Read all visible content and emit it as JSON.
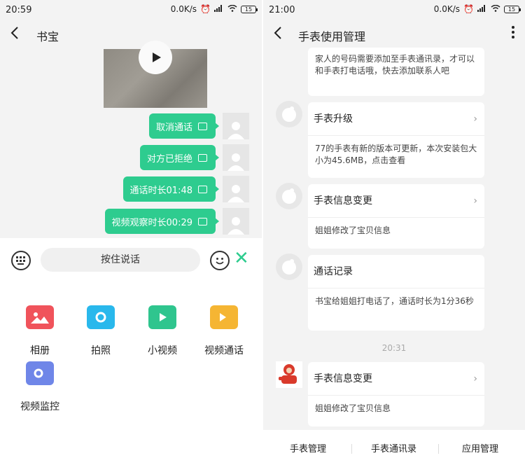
{
  "left": {
    "status": {
      "time": "20:59",
      "speed": "0.0K/s",
      "battery": "15"
    },
    "header": {
      "title": "书宝"
    },
    "messages": [
      {
        "text": "取消通话"
      },
      {
        "text": "对方已拒绝"
      },
      {
        "text": "通话时长01:48"
      },
      {
        "text": "视频观察时长00:29"
      }
    ],
    "input": {
      "hold_to_talk": "按住说话"
    },
    "tools": [
      {
        "label": "相册",
        "icon": "album-icon",
        "color": "#f0535b"
      },
      {
        "label": "拍照",
        "icon": "camera-icon",
        "color": "#29b8ec"
      },
      {
        "label": "小视频",
        "icon": "short-video-icon",
        "color": "#2fc58e"
      },
      {
        "label": "视频通话",
        "icon": "video-call-icon",
        "color": "#f5b533"
      },
      {
        "label": "视频监控",
        "icon": "video-monitor-icon",
        "color": "#6f86e8"
      }
    ],
    "accent": "#2ecc8f"
  },
  "right": {
    "status": {
      "time": "21:00",
      "speed": "0.0K/s",
      "battery": "15"
    },
    "header": {
      "title": "手表使用管理"
    },
    "cards": [
      {
        "title": "",
        "body": "家人的号码需要添加至手表通讯录，才可以和手表打电话哦，快去添加联系人吧"
      },
      {
        "title": "手表升级",
        "body": "77的手表有新的版本可更新，本次安装包大小为45.6MB，点击查看"
      },
      {
        "title": "手表信息变更",
        "body": "姐姐修改了宝贝信息"
      },
      {
        "title": "通话记录",
        "body": "书宝给姐姐打电话了，通话时长为1分36秒"
      },
      {
        "title": "手表信息变更",
        "body": "姐姐修改了宝贝信息"
      }
    ],
    "time_separator": "20:31",
    "tabs": [
      {
        "label": "手表管理"
      },
      {
        "label": "手表通讯录"
      },
      {
        "label": "应用管理"
      }
    ]
  }
}
